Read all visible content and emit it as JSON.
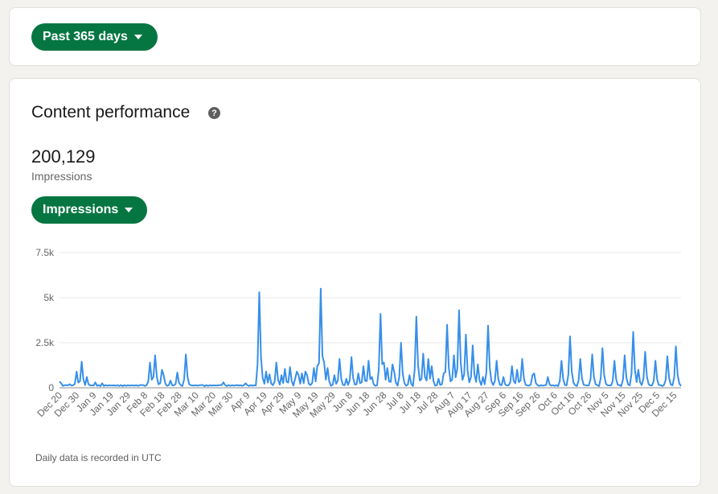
{
  "filter": {
    "date_range_label": "Past 365 days"
  },
  "content_performance": {
    "title": "Content performance",
    "help_glyph": "?",
    "total_value": "200,129",
    "total_label": "Impressions",
    "metric_selector_label": "Impressions",
    "footnote": "Daily data is recorded in UTC"
  },
  "chart_data": {
    "type": "line",
    "ylabel": "",
    "ylim": [
      0,
      7500
    ],
    "y_ticks": [
      "0",
      "2.5k",
      "5k",
      "7.5k"
    ],
    "y_tick_values": [
      0,
      2500,
      5000,
      7500
    ],
    "x_ticks": [
      "Dec 20",
      "Dec 30",
      "Jan 9",
      "Jan 19",
      "Jan 29",
      "Feb 8",
      "Feb 18",
      "Feb 28",
      "Mar 10",
      "Mar 20",
      "Mar 30",
      "Apr 9",
      "Apr 19",
      "Apr 29",
      "May 9",
      "May 19",
      "May 29",
      "Jun 8",
      "Jun 18",
      "Jun 28",
      "Jul 8",
      "Jul 18",
      "Jul 28",
      "Aug 7",
      "Aug 17",
      "Aug 27",
      "Sep 6",
      "Sep 16",
      "Sep 26",
      "Oct 6",
      "Oct 16",
      "Oct 26",
      "Nov 5",
      "Nov 15",
      "Nov 25",
      "Dec 5",
      "Dec 15"
    ],
    "x_tick_day_index": [
      0,
      10,
      20,
      30,
      40,
      50,
      60,
      70,
      80,
      90,
      100,
      110,
      120,
      130,
      140,
      150,
      160,
      170,
      180,
      190,
      200,
      210,
      220,
      230,
      240,
      250,
      260,
      270,
      280,
      290,
      300,
      310,
      320,
      330,
      340,
      350,
      360
    ],
    "num_days": 365,
    "grid": true,
    "line_color": "#378fe9",
    "baseline": 150,
    "peaks": [
      [
        0,
        350
      ],
      [
        1,
        250
      ],
      [
        3,
        150
      ],
      [
        5,
        200
      ],
      [
        8,
        900
      ],
      [
        10,
        1450
      ],
      [
        12,
        600
      ],
      [
        16,
        300
      ],
      [
        19,
        250
      ],
      [
        24,
        50
      ],
      [
        33,
        50
      ],
      [
        36,
        150
      ],
      [
        37,
        150
      ],
      [
        41,
        1400
      ],
      [
        42,
        600
      ],
      [
        43,
        1800
      ],
      [
        44,
        600
      ],
      [
        46,
        1000
      ],
      [
        47,
        700
      ],
      [
        50,
        400
      ],
      [
        53,
        850
      ],
      [
        57,
        1850
      ],
      [
        58,
        500
      ],
      [
        64,
        150
      ],
      [
        72,
        150
      ],
      [
        73,
        150
      ],
      [
        74,
        300
      ],
      [
        80,
        150
      ],
      [
        84,
        250
      ],
      [
        90,
        5300
      ],
      [
        91,
        1200
      ],
      [
        93,
        900
      ],
      [
        95,
        750
      ],
      [
        98,
        1400
      ],
      [
        100,
        700
      ],
      [
        102,
        1050
      ],
      [
        104,
        1150
      ],
      [
        106,
        500
      ],
      [
        107,
        900
      ],
      [
        108,
        700
      ],
      [
        109,
        800
      ],
      [
        111,
        900
      ],
      [
        112,
        700
      ],
      [
        115,
        1100
      ],
      [
        116,
        1200
      ],
      [
        118,
        5500
      ],
      [
        119,
        1400
      ],
      [
        121,
        1100
      ],
      [
        124,
        700
      ],
      [
        126,
        1600
      ],
      [
        129,
        500
      ],
      [
        132,
        1700
      ],
      [
        135,
        800
      ],
      [
        137,
        1200
      ],
      [
        139,
        1500
      ],
      [
        141,
        600
      ],
      [
        145,
        4100
      ],
      [
        146,
        1400
      ],
      [
        148,
        1100
      ],
      [
        150,
        1300
      ],
      [
        151,
        900
      ],
      [
        154,
        2500
      ],
      [
        158,
        700
      ],
      [
        161,
        3950
      ],
      [
        162,
        1100
      ],
      [
        164,
        1900
      ],
      [
        166,
        1600
      ],
      [
        168,
        1200
      ],
      [
        171,
        500
      ],
      [
        173,
        800
      ],
      [
        175,
        3500
      ],
      [
        178,
        1800
      ],
      [
        180,
        4300
      ],
      [
        183,
        2950
      ],
      [
        186,
        2350
      ],
      [
        189,
        1300
      ],
      [
        191,
        600
      ],
      [
        193,
        3450
      ],
      [
        197,
        1500
      ],
      [
        200,
        600
      ],
      [
        204,
        1200
      ],
      [
        206,
        1000
      ],
      [
        209,
        1600
      ],
      [
        213,
        700
      ],
      [
        214,
        800
      ],
      [
        220,
        600
      ],
      [
        226,
        1500
      ],
      [
        230,
        2850
      ],
      [
        235,
        1600
      ],
      [
        240,
        1850
      ],
      [
        245,
        2200
      ],
      [
        250,
        1500
      ],
      [
        255,
        1800
      ],
      [
        259,
        3100
      ],
      [
        261,
        1000
      ],
      [
        264,
        2000
      ],
      [
        269,
        1500
      ],
      [
        274,
        1750
      ],
      [
        278,
        2300
      ]
    ]
  }
}
